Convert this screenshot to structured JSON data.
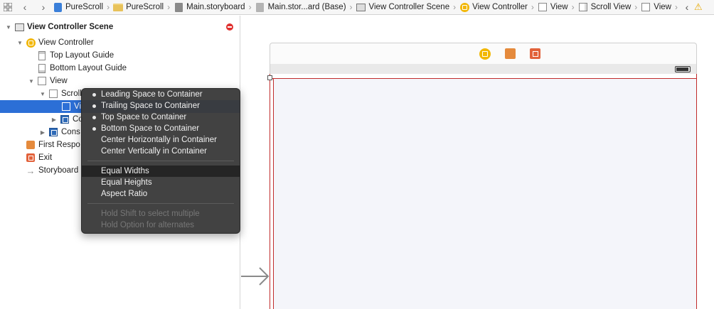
{
  "jumpbar": {
    "crumbs": [
      {
        "label": "PureScroll",
        "icon": "project-file-icon"
      },
      {
        "label": "PureScroll",
        "icon": "folder-icon"
      },
      {
        "label": "Main.storyboard",
        "icon": "storyboard-icon"
      },
      {
        "label": "Main.stor...ard (Base)",
        "icon": "storyboard-base-icon"
      },
      {
        "label": "View Controller Scene",
        "icon": "scene-icon"
      },
      {
        "label": "View Controller",
        "icon": "view-controller-icon"
      },
      {
        "label": "View",
        "icon": "view-icon"
      },
      {
        "label": "Scroll View",
        "icon": "scroll-view-icon"
      },
      {
        "label": "View",
        "icon": "view-icon"
      }
    ]
  },
  "outline": {
    "scene_title": "View Controller Scene",
    "view_controller": "View Controller",
    "top_layout_guide": "Top Layout Guide",
    "bottom_layout_guide": "Bottom Layout Guide",
    "view": "View",
    "scroll_view": "Scroll",
    "selected_view": "Vi",
    "constraints_inner": "Co",
    "constraints_outer": "Cons",
    "first_responder": "First Respo",
    "exit": "Exit",
    "storyboard_entry": "Storyboard"
  },
  "menu": {
    "items": [
      {
        "label": "Leading Space to Container",
        "bullet": true
      },
      {
        "label": "Trailing Space to Container",
        "bullet": true
      },
      {
        "label": "Top Space to Container",
        "bullet": true
      },
      {
        "label": "Bottom Space to Container",
        "bullet": true
      },
      {
        "label": "Center Horizontally in Container",
        "bullet": false
      },
      {
        "label": "Center Vertically in Container",
        "bullet": false
      },
      {
        "label": "Equal Widths",
        "bullet": false,
        "highlighted": true
      },
      {
        "label": "Equal Heights",
        "bullet": false
      },
      {
        "label": "Aspect Ratio",
        "bullet": false
      },
      {
        "label": "Hold Shift to select multiple",
        "bullet": false,
        "disabled": true
      },
      {
        "label": "Hold Option for alternates",
        "bullet": false,
        "disabled": true
      }
    ]
  },
  "colors": {
    "selection": "#2c6fd6",
    "constraint_red": "#c12b2b",
    "menu_bg": "#3a3a3a",
    "view_controller_yellow": "#f2b705"
  }
}
